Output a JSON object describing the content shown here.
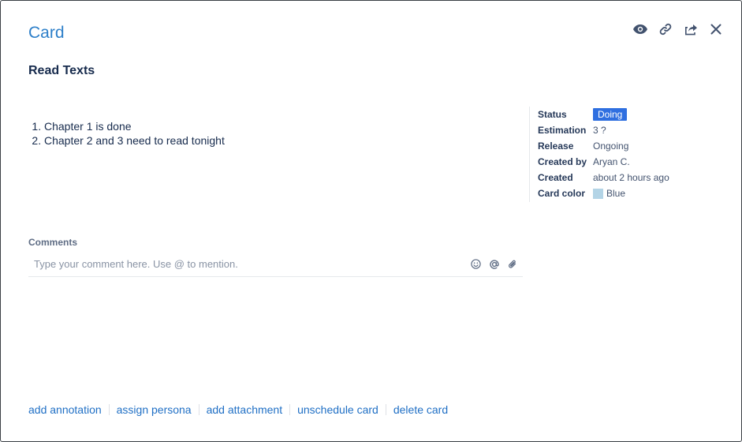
{
  "header": {
    "title": "Card"
  },
  "toolbar": {
    "icons": [
      "eye-icon",
      "link-icon",
      "share-icon",
      "close-icon"
    ]
  },
  "card": {
    "title": "Read Texts",
    "description": [
      "Chapter 1 is done",
      "Chapter 2 and 3 need to read tonight"
    ]
  },
  "meta": {
    "status_label": "Status",
    "status_value": "Doing",
    "estimation_label": "Estimation",
    "estimation_value": "3 ?",
    "release_label": "Release",
    "release_value": "Ongoing",
    "created_by_label": "Created by",
    "created_by_value": "Aryan C.",
    "created_label": "Created",
    "created_value": "about 2 hours ago",
    "card_color_label": "Card color",
    "card_color_value": "Blue"
  },
  "comments": {
    "label": "Comments",
    "placeholder": "Type your comment here. Use @ to mention.",
    "value": ""
  },
  "actions": [
    "add annotation",
    "assign persona",
    "add attachment",
    "unschedule card",
    "delete card"
  ],
  "colors": {
    "accent": "#2d7fc9",
    "status_badge": "#2f6fe0",
    "card_color_swatch": "#b3d4e6",
    "link": "#1f6fc5"
  }
}
